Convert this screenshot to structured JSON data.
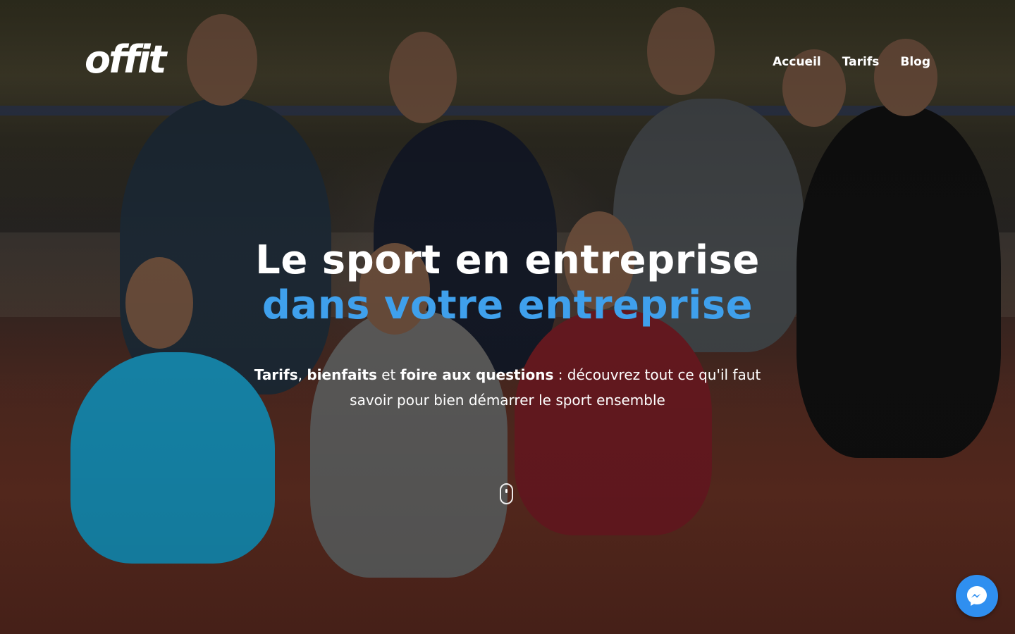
{
  "brand": {
    "logo_text": "offit",
    "accent_color": "#3fa0ec",
    "messenger_color": "#2f8ff0"
  },
  "nav": {
    "items": [
      {
        "label": "Accueil"
      },
      {
        "label": "Tarifs"
      },
      {
        "label": "Blog"
      }
    ]
  },
  "hero": {
    "headline_line1": "Le sport en entreprise",
    "headline_line2": "dans votre entreprise",
    "subtitle": {
      "b1": "Tarifs",
      "sep1": ", ",
      "b2": "bienfaits",
      "sep2": " et ",
      "b3": "foire aux questions",
      "rest": " : découvrez tout ce qu'il faut savoir pour bien démarrer le sport ensemble"
    },
    "background_description_icon": "group-photo-background"
  },
  "widgets": {
    "scroll_icon": "mouse-scroll-icon",
    "chat_icon": "messenger-icon"
  }
}
